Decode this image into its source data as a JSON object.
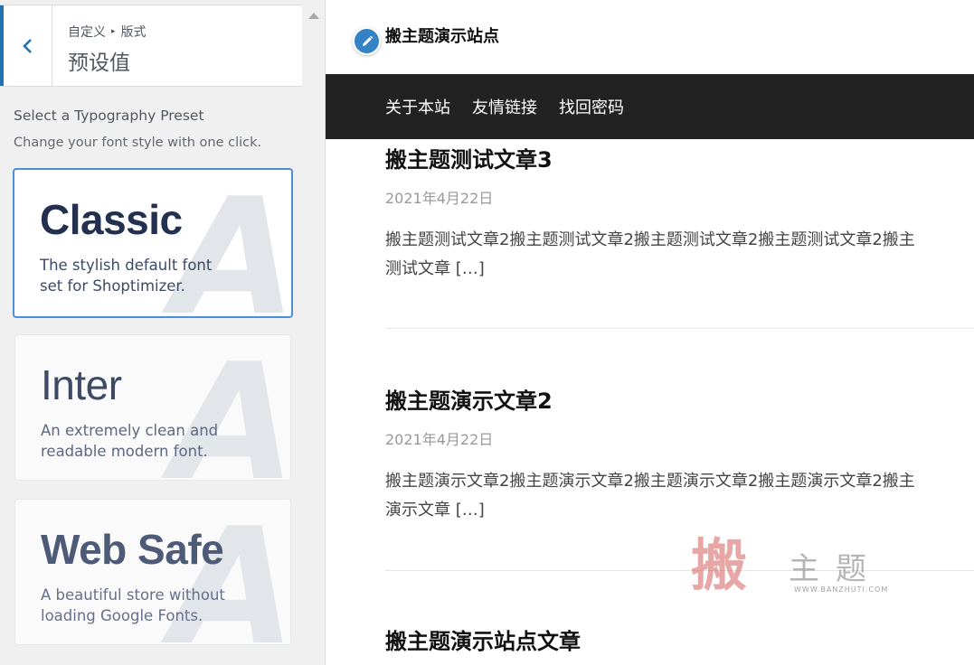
{
  "customizer": {
    "breadcrumb_parent": "自定义",
    "breadcrumb_separator": "▸",
    "breadcrumb_child": "版式",
    "section_title": "预设值",
    "control_title": "Select a Typography Preset",
    "control_description": "Change your font style with one click.",
    "presets": [
      {
        "name": "Classic",
        "description": "The stylish default font set for Shoptimizer.",
        "selected": true
      },
      {
        "name": "Inter",
        "description": "An extremely clean and readable modern font.",
        "selected": false
      },
      {
        "name": "Web Safe",
        "description": "A beautiful store without loading Google Fonts.",
        "selected": false
      }
    ],
    "preset_watermark_letter": "A"
  },
  "preview": {
    "site_title": "搬主题演示站点",
    "nav": [
      "关于本站",
      "友情链接",
      "找回密码"
    ],
    "posts": [
      {
        "title": "搬主题测试文章3",
        "date": "2021年4月22日",
        "excerpt_line1": "搬主题测试文章2搬主题测试文章2搬主题测试文章2搬主题测试文章2搬主",
        "excerpt_line2": "测试文章 […]"
      },
      {
        "title": "搬主题演示文章2",
        "date": "2021年4月22日",
        "excerpt_line1": "搬主题演示文章2搬主题演示文章2搬主题演示文章2搬主题演示文章2搬主",
        "excerpt_line2": "演示文章 […]"
      },
      {
        "title": "搬主题演示站点文章"
      }
    ],
    "watermark": {
      "seal": "搬",
      "text": "主题",
      "url": "WWW.BANZHUTI.COM"
    }
  },
  "colors": {
    "accent_blue": "#2271b1",
    "selected_border": "#4a8fd8",
    "navbar_bg": "#222222",
    "edit_icon_bg": "#3582c4"
  }
}
